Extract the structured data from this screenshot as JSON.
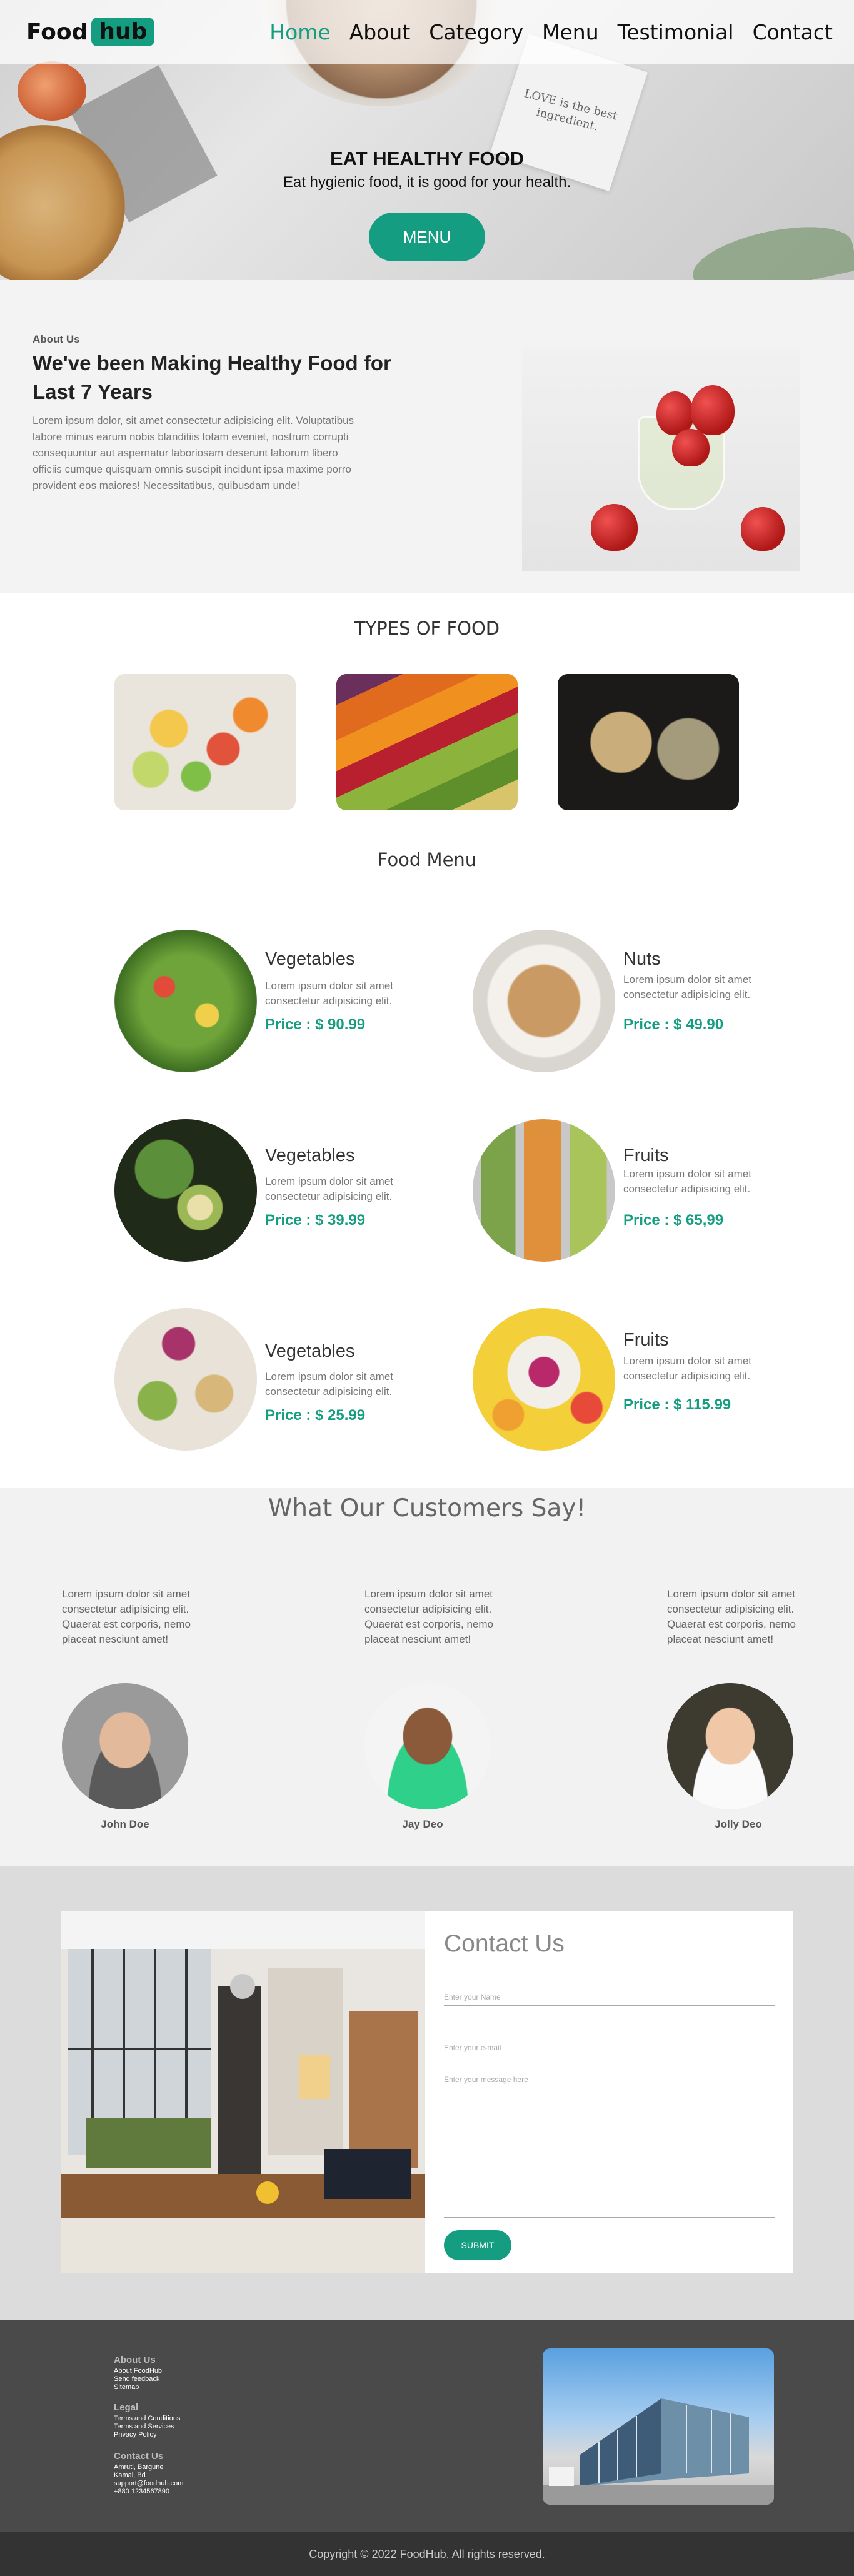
{
  "nav": {
    "logo_food": "Food",
    "logo_hub": "hub",
    "items": [
      {
        "label": "Home",
        "active": true
      },
      {
        "label": "About",
        "active": false
      },
      {
        "label": "Category",
        "active": false
      },
      {
        "label": "Menu",
        "active": false
      },
      {
        "label": "Testimonial",
        "active": false
      },
      {
        "label": "Contact",
        "active": false
      }
    ]
  },
  "hero": {
    "title": "EAT HEALTHY FOOD",
    "subtitle": "Eat hygienic food, it is good for your health.",
    "button": "MENU",
    "paper_text": "LOVE is the best ingredient."
  },
  "about": {
    "kicker": "About Us",
    "title": "We've been Making Healthy Food for Last 7 Years",
    "text": "Lorem ipsum dolor, sit amet consectetur adipisicing elit. Voluptatibus labore minus earum nobis blanditiis totam eveniet, nostrum corrupti consequuntur aut aspernatur laboriosam deserunt laborum libero officiis cumque quisquam omnis suscipit incidunt ipsa maxime porro provident eos maiores! Necessitatibus, quibusdam unde!"
  },
  "types": {
    "title": "TYPES OF FOOD",
    "cards": [
      "fruit-bowl",
      "vegetable-rows",
      "nuts-and-seeds"
    ]
  },
  "food_menu": {
    "title": "Food Menu",
    "items": [
      {
        "name": "Vegetables",
        "desc": "Lorem ipsum dolor sit amet consectetur adipisicing elit.",
        "price": "Price : $ 90.99"
      },
      {
        "name": "Nuts",
        "desc": "Lorem ipsum dolor sit amet consectetur adipisicing elit.",
        "price": "Price : $ 49.90"
      },
      {
        "name": "Vegetables",
        "desc": "Lorem ipsum dolor sit amet consectetur adipisicing elit.",
        "price": "Price : $ 39.99"
      },
      {
        "name": "Fruits",
        "desc": "Lorem ipsum dolor sit amet consectetur adipisicing elit.",
        "price": "Price : $ 65,99"
      },
      {
        "name": "Vegetables",
        "desc": "Lorem ipsum dolor sit amet consectetur adipisicing elit.",
        "price": "Price : $ 25.99"
      },
      {
        "name": "Fruits",
        "desc": "Lorem ipsum dolor sit amet consectetur adipisicing elit.",
        "price": "Price : $ 115.99"
      }
    ]
  },
  "testimonials": {
    "title": "What Our Customers Say!",
    "items": [
      {
        "text": "Lorem ipsum dolor sit amet consectetur adipisicing elit. Quaerat est corporis, nemo placeat nesciunt amet!",
        "name": "John Doe"
      },
      {
        "text": "Lorem ipsum dolor sit amet consectetur adipisicing elit. Quaerat est corporis, nemo placeat nesciunt amet!",
        "name": "Jay Deo"
      },
      {
        "text": "Lorem ipsum dolor sit amet consectetur adipisicing elit. Quaerat est corporis, nemo placeat nesciunt amet!",
        "name": "Jolly Deo"
      }
    ]
  },
  "contact": {
    "title": "Contact Us",
    "name_placeholder": "Enter your Name",
    "email_placeholder": "Enter your e-mail",
    "message_placeholder": "Enter your message here",
    "submit": "SUBMIT"
  },
  "footer": {
    "about_head": "About Us",
    "about_links": [
      "About FoodHub",
      "Send feedback",
      "Sitemap"
    ],
    "legal_head": "Legal",
    "legal_links": [
      "Terms and Conditions",
      "Terms and Services",
      "Privacy Policy"
    ],
    "contact_head": "Contact Us",
    "contact_lines": [
      "Amruti, Bargune",
      "Kamal, Bd",
      "support@foodhub.com",
      "+880 1234567890"
    ],
    "copyright": "Copyright © 2022 FoodHub. All rights reserved."
  },
  "colors": {
    "accent": "#149d80",
    "footer_bg": "#4a4a4a",
    "copyright_bg": "#333333"
  }
}
